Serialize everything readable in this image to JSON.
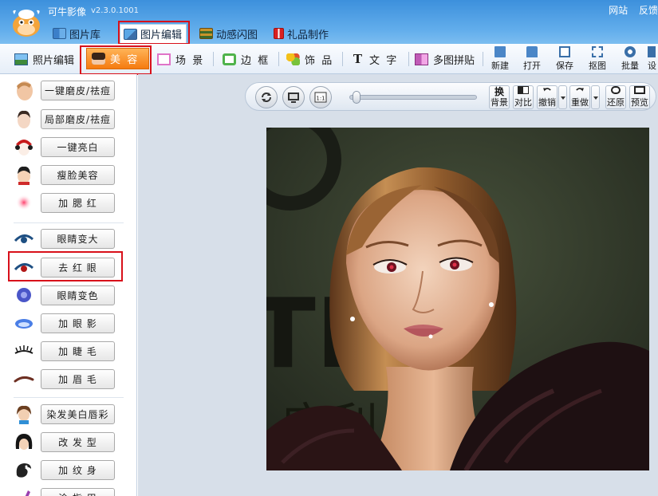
{
  "app": {
    "title": "可牛影像",
    "version": "v2.3.0.1001",
    "top_links": [
      "网站",
      "反馈"
    ]
  },
  "main_tabs": [
    {
      "label": "图片库",
      "icon": "grid-icon"
    },
    {
      "label": "图片编辑",
      "icon": "image-edit-icon",
      "active": true
    },
    {
      "label": "动感闪图",
      "icon": "film-strip-icon"
    },
    {
      "label": "礼品制作",
      "icon": "gift-icon"
    }
  ],
  "sub_tabs": [
    {
      "label": "照片编辑",
      "icon": "photo-icon"
    },
    {
      "label": "美  容",
      "icon": "face-icon",
      "active": true
    },
    {
      "label": "场  景",
      "icon": "scene-icon"
    },
    {
      "label": "边  框",
      "icon": "frame-icon"
    },
    {
      "label": "饰  品",
      "icon": "ornament-icon"
    },
    {
      "label": "文  字",
      "icon": "text-icon"
    },
    {
      "label": "多图拼贴",
      "icon": "collage-icon"
    }
  ],
  "toolbar_buttons": [
    {
      "label": "新建",
      "icon": "new-file-icon"
    },
    {
      "label": "打开",
      "icon": "open-folder-icon"
    },
    {
      "label": "保存",
      "icon": "save-icon"
    },
    {
      "label": "抠图",
      "icon": "cutout-icon"
    },
    {
      "label": "批量",
      "icon": "batch-gear-icon"
    },
    {
      "label": "设",
      "icon": "settings-icon"
    }
  ],
  "beauty_tools": [
    {
      "label": "一键磨皮/祛痘",
      "icon": "skin-smooth-icon"
    },
    {
      "label": "局部磨皮/祛痘",
      "icon": "spot-smooth-icon"
    },
    {
      "label": "一键亮白",
      "icon": "whiten-icon"
    },
    {
      "label": "瘦脸美容",
      "icon": "slim-face-icon"
    },
    {
      "label": "加 腮 红",
      "icon": "blush-icon"
    },
    {
      "label": "眼睛变大",
      "icon": "enlarge-eye-icon"
    },
    {
      "label": "去 红 眼",
      "icon": "red-eye-icon",
      "highlighted": true
    },
    {
      "label": "眼睛变色",
      "icon": "eye-color-icon"
    },
    {
      "label": "加 眼 影",
      "icon": "eye-shadow-icon"
    },
    {
      "label": "加 睫 毛",
      "icon": "eyelash-icon"
    },
    {
      "label": "加 眉 毛",
      "icon": "eyebrow-icon"
    },
    {
      "label": "染发美白唇彩",
      "icon": "hair-dye-icon"
    },
    {
      "label": "改 发 型",
      "icon": "hairstyle-icon"
    },
    {
      "label": "加 纹 身",
      "icon": "tattoo-icon"
    },
    {
      "label": "涂 指 甲",
      "icon": "nail-icon"
    }
  ],
  "view_toolbar": {
    "zoom_fraction": 0.02,
    "buttons": [
      {
        "label": "换\n背景",
        "top": "换",
        "bottom": "背景",
        "icon": "swap-bg-icon"
      },
      {
        "top": "",
        "bottom": "对比",
        "icon": "compare-icon"
      },
      {
        "top": "",
        "bottom": "撤销",
        "icon": "undo-icon"
      },
      {
        "top": "",
        "bottom": "重做",
        "icon": "redo-icon"
      },
      {
        "top": "",
        "bottom": "还原",
        "icon": "restore-icon"
      },
      {
        "top": "",
        "bottom": "预览",
        "icon": "preview-icon"
      }
    ],
    "one_to_one_label": "1:1"
  },
  "photo": {
    "bg_letters": "TLE",
    "bg_chinese": "宝利"
  }
}
